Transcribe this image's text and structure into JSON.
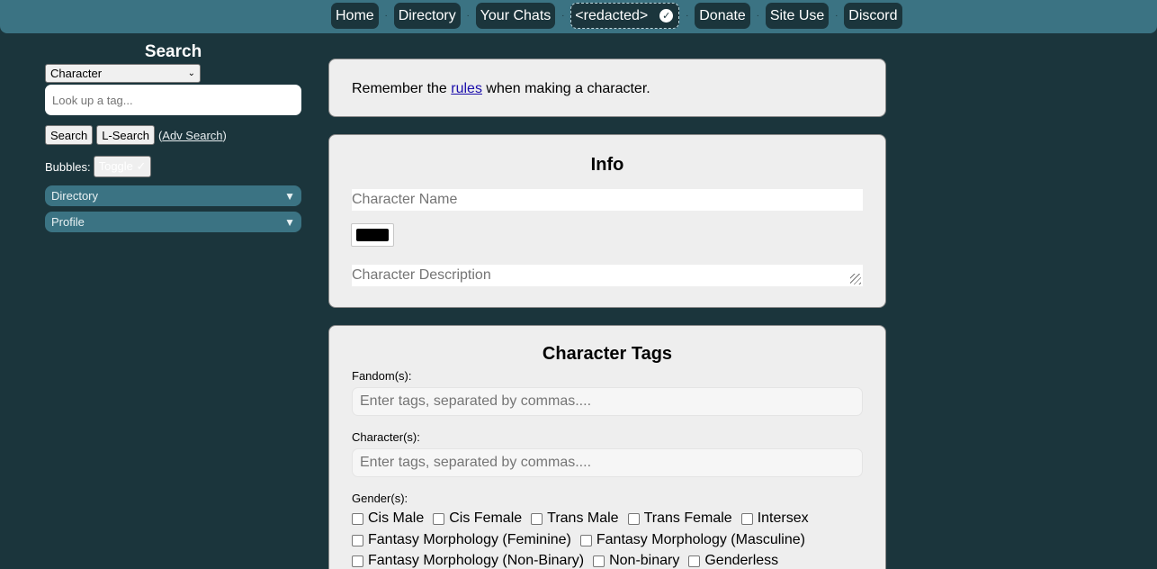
{
  "nav": {
    "items": [
      "Home",
      "Directory",
      "Your Chats",
      "<redacted>",
      "Donate",
      "Site Use",
      "Discord"
    ],
    "separator": "·"
  },
  "sidebar": {
    "search_title": "Search",
    "select_value": "Character",
    "tag_placeholder": "Look up a tag...",
    "search_button": "Search",
    "lsearch_button": "L-Search",
    "adv_search": "Adv Search",
    "bubbles_label": "Bubbles:",
    "toggle_button": "Toggle ✓",
    "sections": [
      "Directory",
      "Profile"
    ]
  },
  "notice": {
    "before": "Remember the ",
    "link": "rules",
    "after": " when making a character."
  },
  "info": {
    "title": "Info",
    "name_placeholder": "Character Name",
    "color_value": "#000000",
    "desc_placeholder": "Character Description"
  },
  "tags": {
    "title": "Character Tags",
    "fandom_label": "Fandom(s):",
    "fandom_placeholder": "Enter tags, separated by commas....",
    "character_label": "Character(s):",
    "character_placeholder": "Enter tags, separated by commas....",
    "gender_label": "Gender(s):",
    "genders": [
      [
        "Cis Male",
        "Cis Female",
        "Trans Male",
        "Trans Female",
        "Intersex"
      ],
      [
        "Fantasy Morphology (Feminine)",
        "Fantasy Morphology (Masculine)"
      ],
      [
        "Fantasy Morphology (Non-Binary)",
        "Non-binary",
        "Genderless"
      ]
    ]
  },
  "colors": {
    "background": "#1b353c",
    "topbar": "#3b7383",
    "panel": "#eeeeee",
    "link": "#1a0dab"
  }
}
